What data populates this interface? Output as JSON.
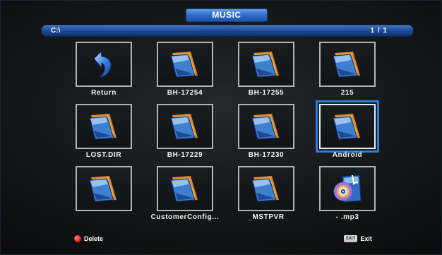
{
  "header": {
    "title": "MUSIC"
  },
  "pathbar": {
    "path": "C:\\",
    "page": "1 / 1"
  },
  "items": [
    {
      "label": "Return",
      "icon": "return-arrow-icon"
    },
    {
      "label": "BH-17254",
      "icon": "folder-icon"
    },
    {
      "label": "BH-17255",
      "icon": "folder-icon"
    },
    {
      "label": "215",
      "icon": "folder-icon"
    },
    {
      "label": "LOST.DIR",
      "icon": "folder-icon"
    },
    {
      "label": "BH-17229",
      "icon": "folder-icon"
    },
    {
      "label": "BH-17230",
      "icon": "folder-icon"
    },
    {
      "label": "Android",
      "icon": "folder-icon",
      "selected": true
    },
    {
      "label": "",
      "icon": "folder-icon"
    },
    {
      "label": "CustomerConfig...",
      "icon": "folder-icon"
    },
    {
      "label": "_MSTPVR",
      "icon": "folder-icon"
    },
    {
      "label": "- .mp3",
      "icon": "music-file-icon"
    }
  ],
  "footer": {
    "delete_label": "Delete",
    "exit_key": "EXIT",
    "exit_label": "Exit"
  },
  "colors": {
    "accent": "#2a69c6",
    "selection": "#2f7be0",
    "delete_button": "#e0241a",
    "folder_orange": "#f0a020"
  }
}
